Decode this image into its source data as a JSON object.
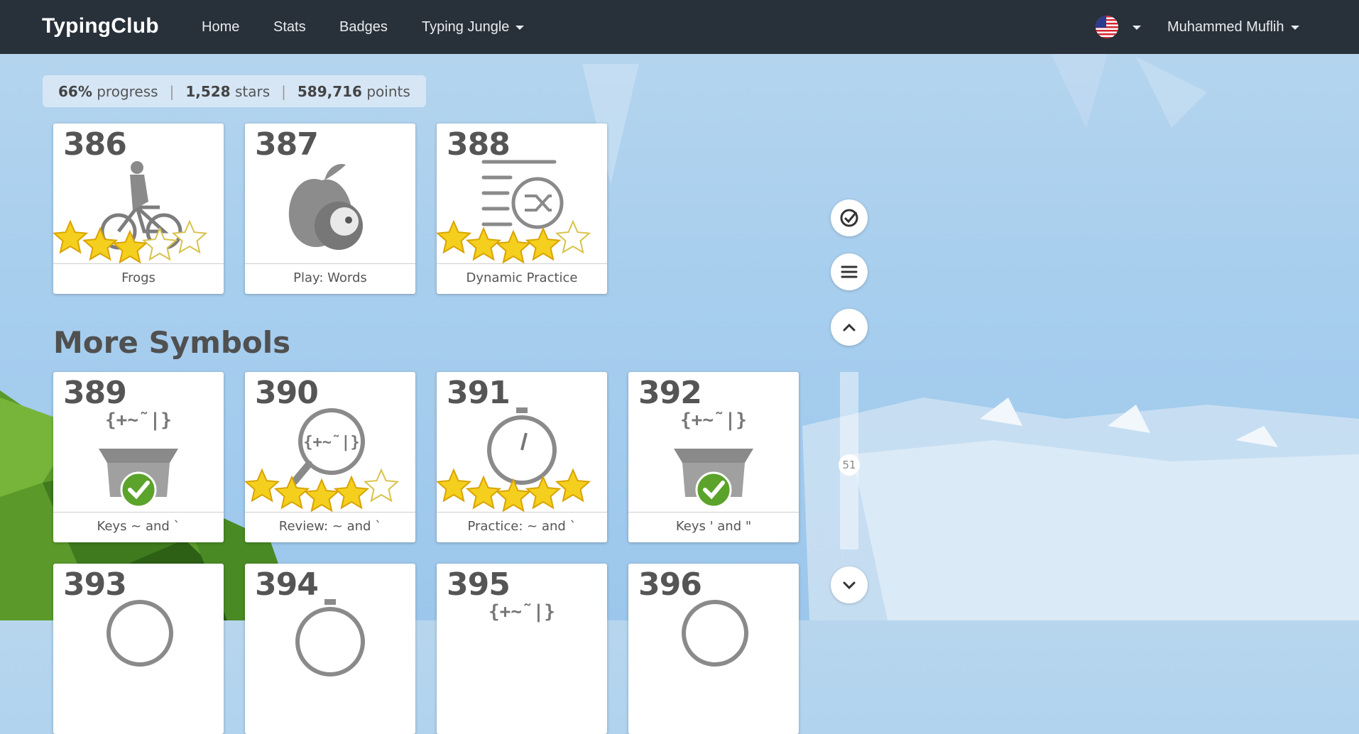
{
  "navbar": {
    "brand": "TypingClub",
    "links": [
      "Home",
      "Stats",
      "Badges",
      "Typing Jungle"
    ],
    "user": "Muhammed Muflih"
  },
  "progress": {
    "percent": "66%",
    "percent_label": "progress",
    "stars": "1,528",
    "stars_label": "stars",
    "points": "589,716",
    "points_label": "points"
  },
  "section_title": "More Symbols",
  "lessons": [
    {
      "num": "386",
      "label": "Frogs",
      "stars": 3
    },
    {
      "num": "387",
      "label": "Play: Words"
    },
    {
      "num": "388",
      "label": "Dynamic Practice",
      "stars": 4
    },
    {
      "num": "389",
      "label": "Keys ~ and `",
      "completed": true
    },
    {
      "num": "390",
      "label": "Review: ~ and `",
      "stars": 4
    },
    {
      "num": "391",
      "label": "Practice: ~ and `",
      "stars": 5
    },
    {
      "num": "392",
      "label": "Keys ' and \"",
      "completed": true
    },
    {
      "num": "393",
      "label": ""
    },
    {
      "num": "394",
      "label": ""
    },
    {
      "num": "395",
      "label": ""
    },
    {
      "num": "396",
      "label": ""
    }
  ],
  "box_symbols": "{+~̃ |}",
  "scroll_position": "51",
  "colors": {
    "navbar": "#283039",
    "star": "#f5cf1d",
    "check": "#5ba32b"
  }
}
